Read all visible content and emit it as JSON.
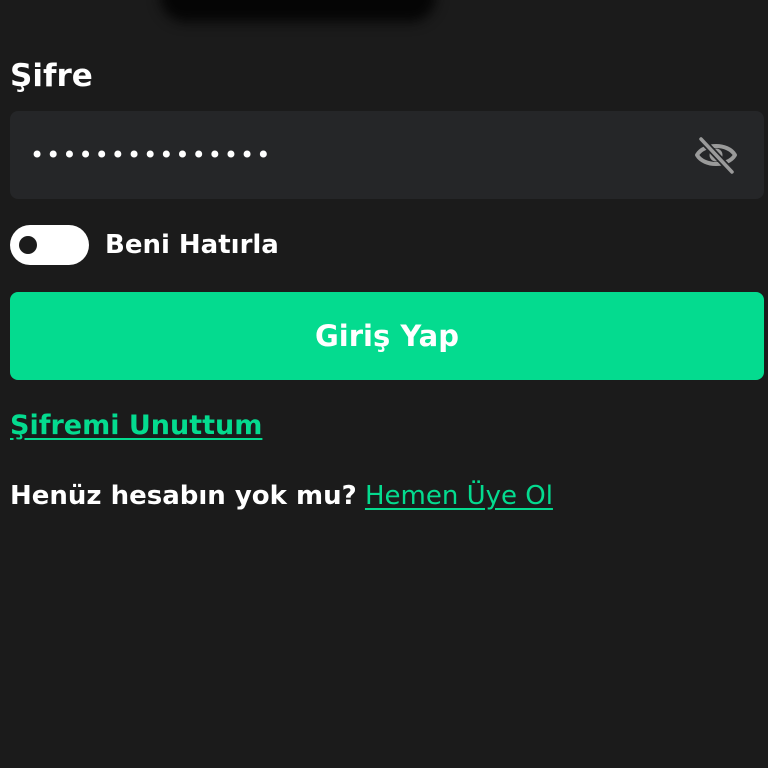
{
  "password_section": {
    "label": "Şifre",
    "value": "•••••••••••••••",
    "visibility_icon": "eye-off-icon"
  },
  "remember_me": {
    "label": "Beni Hatırla",
    "checked": false
  },
  "login_button": {
    "label": "Giriş Yap"
  },
  "forgot_password": {
    "label": "Şifremi Unuttum"
  },
  "signup": {
    "question": "Henüz hesabın yok mu?",
    "link_label": "Hemen Üye Ol"
  },
  "colors": {
    "background": "#1b1b1b",
    "field_background": "#252628",
    "accent": "#04db8f",
    "text": "#ffffff",
    "icon": "#9a9a9a"
  }
}
